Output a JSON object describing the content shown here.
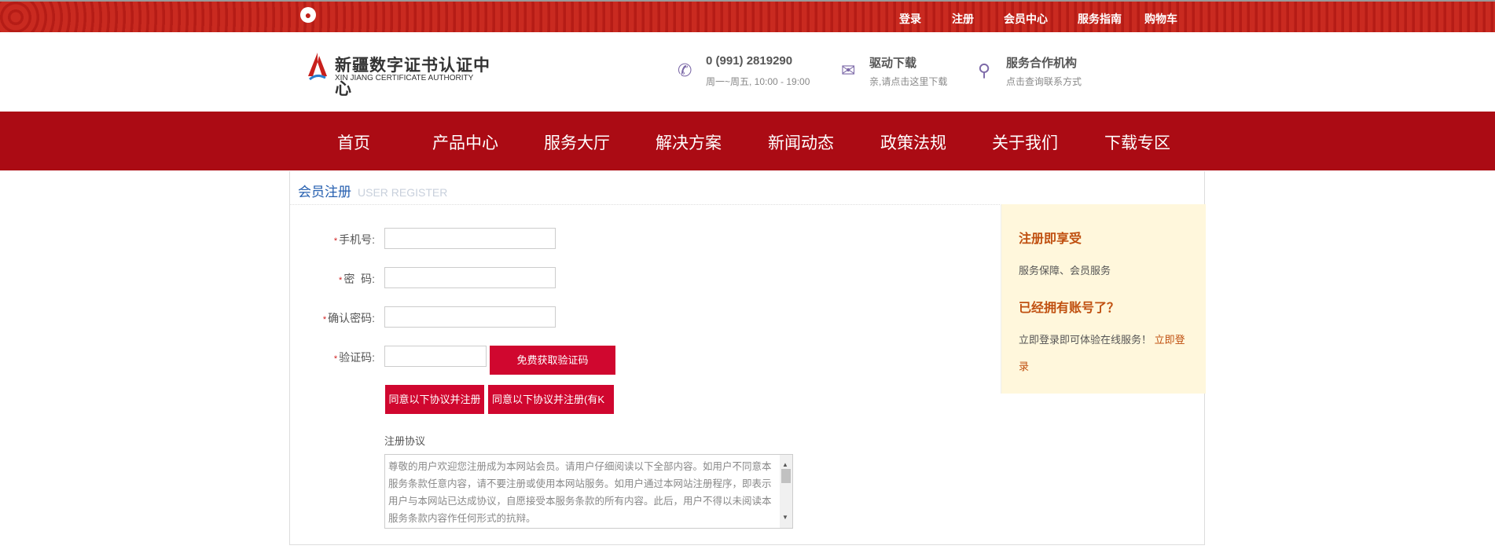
{
  "topbar": {
    "links": [
      "登录",
      "注册",
      "会员中心",
      "服务指南",
      "购物车"
    ]
  },
  "header": {
    "logo_cn": "新疆数字证书认证中心",
    "logo_en": "XIN JIANG CERTIFICATE AUTHORITY",
    "phone": {
      "title": "0 (991) 2819290",
      "sub": "周一~周五, 10:00 - 19:00",
      "icon": "phone-icon"
    },
    "driver": {
      "title": "驱动下载",
      "sub": "亲,请点击这里下载",
      "icon": "mail-icon"
    },
    "partner": {
      "title": "服务合作机构",
      "sub": "点击查询联系方式",
      "icon": "location-pin-icon"
    }
  },
  "nav": [
    "首页",
    "产品中心",
    "服务大厅",
    "解决方案",
    "新闻动态",
    "政策法规",
    "关于我们",
    "下载专区"
  ],
  "panel": {
    "title": "会员注册",
    "subtitle": "USER REGISTER"
  },
  "form": {
    "phone_label": "手机号:",
    "password_label": "密  码:",
    "confirm_label": "确认密码:",
    "code_label": "验证码:",
    "required_mark": "*",
    "phone_value": "",
    "password_value": "",
    "confirm_value": "",
    "code_value": "",
    "get_code": "免费获取验证码",
    "agree1": "同意以下协议并注册",
    "agree2": "同意以下协议并注册(有K",
    "agreement_label": "注册协议",
    "agreement_text": "尊敬的用户欢迎您注册成为本网站会员。请用户仔细阅读以下全部内容。如用户不同意本服务条款任意内容，请不要注册或使用本网站服务。如用户通过本网站注册程序，即表示用户与本网站已达成协议，自愿接受本服务条款的所有内容。此后，用户不得以未阅读本服务条款内容作任何形式的抗辩。"
  },
  "side": {
    "h1": "注册即享受",
    "p1": "服务保障、会员服务",
    "h2": "已经拥有账号了？",
    "p2": "立即登录即可体验在线服务！ ",
    "login_link": "立即登录"
  }
}
